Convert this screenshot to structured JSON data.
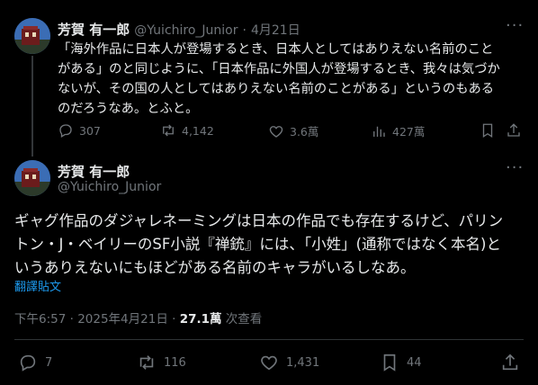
{
  "tweet1": {
    "author_name": "芳賀 有一郎",
    "author_handle": "@Yuichiro_Junior",
    "separator": "·",
    "date": "4月21日",
    "text_lines": [
      "「海外作品に日本人が登場するとき、日本人としてはありえない名前のこと",
      "がある」のと同じように、「日本作品に外国人が登場するとき、我々は気づか",
      "ないが、その国の人としてはありえない名前のことがある」というのもある",
      "のだろうなあ。とふと。"
    ],
    "replies": "307",
    "retweets": "4,142",
    "likes": "3.6萬",
    "views": "427萬"
  },
  "tweet2": {
    "author_name": "芳賀 有一郎",
    "author_handle": "@Yuichiro_Junior",
    "text_lines": [
      "ギャグ作品のダジャレネーミングは日本の作品でも存在するけど、パリン",
      "トン・J・ベイリーのSF小説『禅銃』には、「小姓」(通称ではなく本名)と",
      "いうありえないにもほどがある名前のキャラがいるしなあ。"
    ],
    "translate_label": "翻譯貼文",
    "time": "下午6:57 · 2025年4月21日 · ",
    "views_count": "27.1萬",
    "views_label": " 次查看",
    "replies": "7",
    "retweets": "116",
    "likes": "1,431",
    "bookmarks": "44"
  },
  "icons": {
    "reply": "reply-icon",
    "retweet": "retweet-icon",
    "like": "heart-icon",
    "views": "views-icon",
    "bookmark": "bookmark-icon",
    "share": "share-icon",
    "more": "more-icon"
  },
  "colors": {
    "background": "#000000",
    "text": "#e7e9ea",
    "muted": "#71767b",
    "link": "#1d9bf0"
  }
}
